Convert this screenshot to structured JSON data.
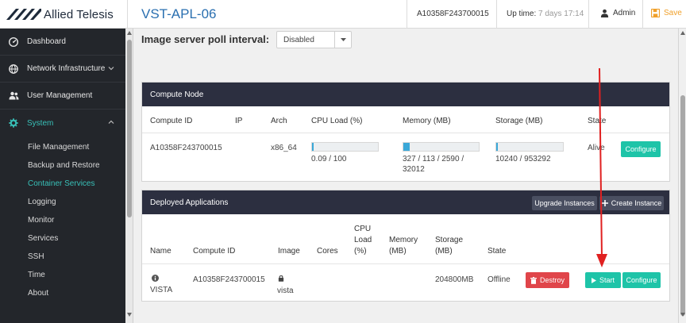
{
  "header": {
    "brand": "Allied Telesis",
    "title": "VST-APL-06",
    "serial": "A10358F243700015",
    "uptime_label": "Up time:",
    "uptime_value": "7 days 17:14",
    "user": "Admin",
    "save": "Save",
    "colors": {
      "title": "#2a6fb0",
      "save": "#f0a02a"
    }
  },
  "sidebar": {
    "items": [
      {
        "label": "Dashboard",
        "icon": "speedometer-icon"
      },
      {
        "label": "Network Infrastructure",
        "icon": "globe-icon"
      },
      {
        "label": "User Management",
        "icon": "users-icon"
      },
      {
        "label": "System",
        "icon": "gear-icon"
      }
    ],
    "system_sub": [
      "File Management",
      "Backup and Restore",
      "Container Services",
      "Logging",
      "Monitor",
      "Services",
      "SSH",
      "Time",
      "About"
    ],
    "active_sub": "Container Services",
    "colors": {
      "bg": "#23262b",
      "active": "#38c0b8"
    }
  },
  "poll": {
    "label": "Image server poll interval:",
    "value": "Disabled"
  },
  "compute_node": {
    "title": "Compute Node",
    "columns": [
      "Compute ID",
      "IP",
      "Arch",
      "CPU Load (%)",
      "Memory (MB)",
      "Storage (MB)",
      "State"
    ],
    "row": {
      "compute_id": "A10358F243700015",
      "ip": "",
      "arch": "x86_64",
      "cpu_text": "0.09 / 100",
      "cpu_fraction": 0.001,
      "mem_line1": "327 / 113 / 2590 /",
      "mem_line2": "32012",
      "mem_fraction": 0.08,
      "storage_text": "10240 / 953292",
      "storage_fraction": 0.011,
      "state": "Alive",
      "configure": "Configure"
    }
  },
  "deployed": {
    "title": "Deployed Applications",
    "upgrade": "Upgrade Instances",
    "create": "Create Instance",
    "columns": {
      "name": "Name",
      "compute_id": "Compute ID",
      "image": "Image",
      "cores": "Cores",
      "cpu_1": "CPU",
      "cpu_2": "Load",
      "cpu_3": "(%)",
      "mem_1": "Memory",
      "mem_2": "(MB)",
      "sto_1": "Storage",
      "sto_2": "(MB)",
      "state": "State"
    },
    "row": {
      "name": "VISTA",
      "compute_id": "A10358F243700015",
      "image": "vista",
      "cores": "",
      "cpu": "",
      "memory": "",
      "storage": "204800MB",
      "state": "Offline",
      "destroy": "Destroy",
      "start": "Start",
      "configure": "Configure"
    }
  },
  "annotation": {
    "arrow_color": "#e02020"
  }
}
